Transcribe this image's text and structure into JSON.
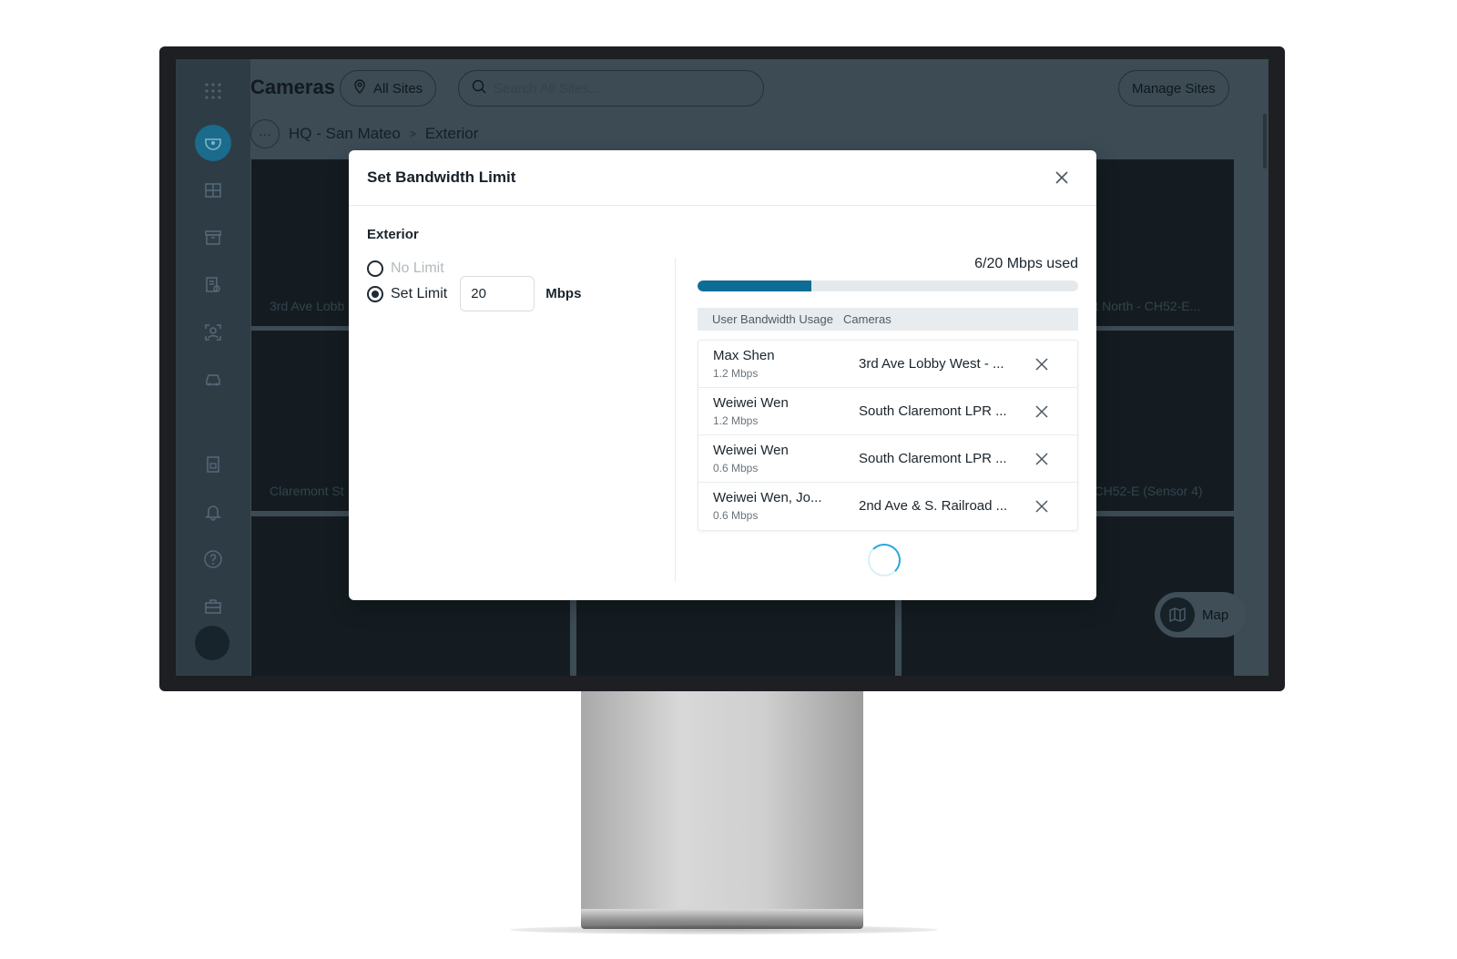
{
  "app": {
    "title": "Cameras",
    "site_filter_label": "All Sites",
    "search_placeholder": "Search All Sites...",
    "manage_sites_label": "Manage Sites",
    "breadcrumb": {
      "more": "···",
      "parent": "HQ - San Mateo",
      "separator": ">",
      "current": "Exterior"
    },
    "tiles": [
      {
        "label": "3rd Ave Lobb"
      },
      {
        "label": "St North - CH52-E..."
      },
      {
        "label": "Claremont St"
      },
      {
        "label": "- CH52-E (Sensor 4)"
      }
    ],
    "map_label": "Map"
  },
  "modal": {
    "title": "Set Bandwidth Limit",
    "section": "Exterior",
    "options": {
      "no_limit": "No Limit",
      "set_limit": "Set Limit",
      "selected": "set_limit"
    },
    "limit_value": "20",
    "limit_unit": "Mbps",
    "usage_text": "6/20 Mbps used",
    "usage_fraction": 0.3,
    "table": {
      "col_user": "User Bandwidth Usage",
      "col_cameras": "Cameras",
      "rows": [
        {
          "name": "Max Shen",
          "rate": "1.2 Mbps",
          "camera": "3rd Ave Lobby West - ..."
        },
        {
          "name": "Weiwei Wen",
          "rate": "1.2 Mbps",
          "camera": "South Claremont LPR ..."
        },
        {
          "name": "Weiwei Wen",
          "rate": "0.6 Mbps",
          "camera": "South Claremont LPR ..."
        },
        {
          "name": "Weiwei Wen, Jo...",
          "rate": "0.6 Mbps",
          "camera": "2nd Ave & S. Railroad ..."
        }
      ]
    }
  },
  "colors": {
    "accent": "#0e6d96",
    "spinner": "#27a7df"
  }
}
